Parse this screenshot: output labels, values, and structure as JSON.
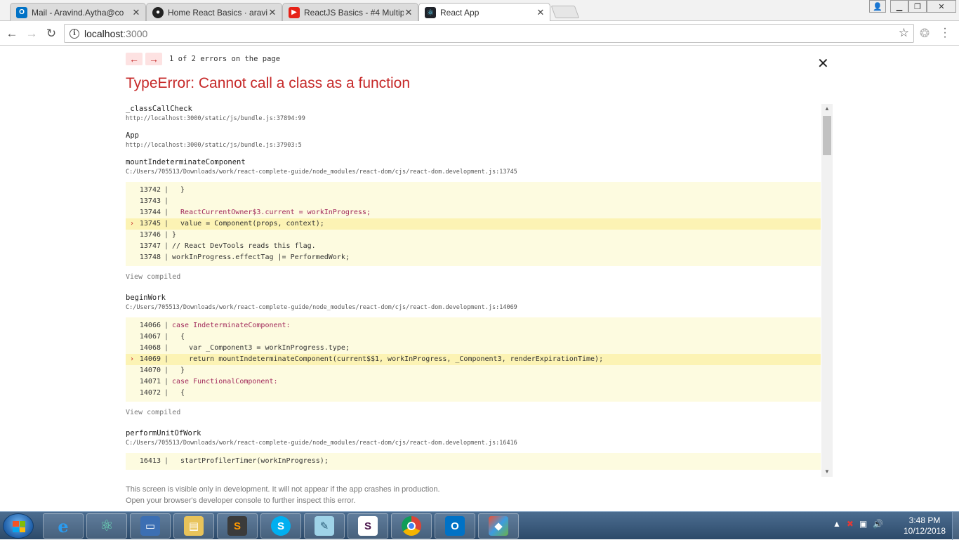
{
  "browser": {
    "tabs": [
      {
        "title": "Mail - Aravind.Aytha@co",
        "icon": "outlook-icon",
        "color": "#0072c6"
      },
      {
        "title": "Home React Basics · aravi",
        "icon": "github-icon",
        "color": "#222222"
      },
      {
        "title": "ReactJS Basics - #4 Multip",
        "icon": "youtube-icon",
        "color": "#e62117"
      },
      {
        "title": "React App",
        "icon": "react-icon",
        "color": "#61dafb"
      }
    ],
    "url_host": "localhost",
    "url_port": ":3000"
  },
  "overlay": {
    "error_count": "1 of 2 errors on the page",
    "title": "TypeError: Cannot call a class as a function",
    "view_compiled": "View compiled",
    "frames": {
      "f1": {
        "name": "_classCallCheck",
        "file": "http://localhost:3000/static/js/bundle.js:37894:99"
      },
      "f2": {
        "name": "App",
        "file": "http://localhost:3000/static/js/bundle.js:37903:5"
      },
      "f3": {
        "name": "mountIndeterminateComponent",
        "file": "C:/Users/705513/Downloads/work/react-complete-guide/node_modules/react-dom/cjs/react-dom.development.js:13745",
        "lines": [
          {
            "n": "13742",
            "code": "  }"
          },
          {
            "n": "13743",
            "code": ""
          },
          {
            "n": "13744",
            "code": "  ReactCurrentOwner$3.current = workInProgress;"
          },
          {
            "n": "13745",
            "code": "  value = Component(props, context);"
          },
          {
            "n": "13746",
            "code": "}"
          },
          {
            "n": "13747",
            "code": "// React DevTools reads this flag."
          },
          {
            "n": "13748",
            "code": "workInProgress.effectTag |= PerformedWork;"
          }
        ]
      },
      "f4": {
        "name": "beginWork",
        "file": "C:/Users/705513/Downloads/work/react-complete-guide/node_modules/react-dom/cjs/react-dom.development.js:14069",
        "lines": [
          {
            "n": "14066",
            "code": "case IndeterminateComponent:"
          },
          {
            "n": "14067",
            "code": "  {"
          },
          {
            "n": "14068",
            "code": "    var _Component3 = workInProgress.type;"
          },
          {
            "n": "14069",
            "code": "    return mountIndeterminateComponent(current$$1, workInProgress, _Component3, renderExpirationTime);"
          },
          {
            "n": "14070",
            "code": "  }"
          },
          {
            "n": "14071",
            "code": "case FunctionalComponent:"
          },
          {
            "n": "14072",
            "code": "  {"
          }
        ]
      },
      "f5": {
        "name": "performUnitOfWork",
        "file": "C:/Users/705513/Downloads/work/react-complete-guide/node_modules/react-dom/cjs/react-dom.development.js:16416",
        "lines": [
          {
            "n": "16413",
            "code": "  startProfilerTimer(workInProgress);"
          }
        ]
      }
    },
    "footer_line1": "This screen is visible only in development. It will not appear if the app crashes in production.",
    "footer_line2": "Open your browser's developer console to further inspect this error."
  },
  "taskbar": {
    "apps": [
      "internet-explorer-icon",
      "atom-icon",
      "remote-desktop-icon",
      "file-explorer-icon",
      "sublime-text-icon",
      "skype-icon",
      "notepad-icon",
      "slack-icon",
      "chrome-icon",
      "outlook-icon",
      "git-icon"
    ],
    "clock_time": "3:48 PM",
    "clock_date": "10/12/2018"
  },
  "colors": {
    "error_red": "#c62828",
    "code_bg": "#fdfbe0",
    "highlight_bg": "#fcf3b4"
  }
}
